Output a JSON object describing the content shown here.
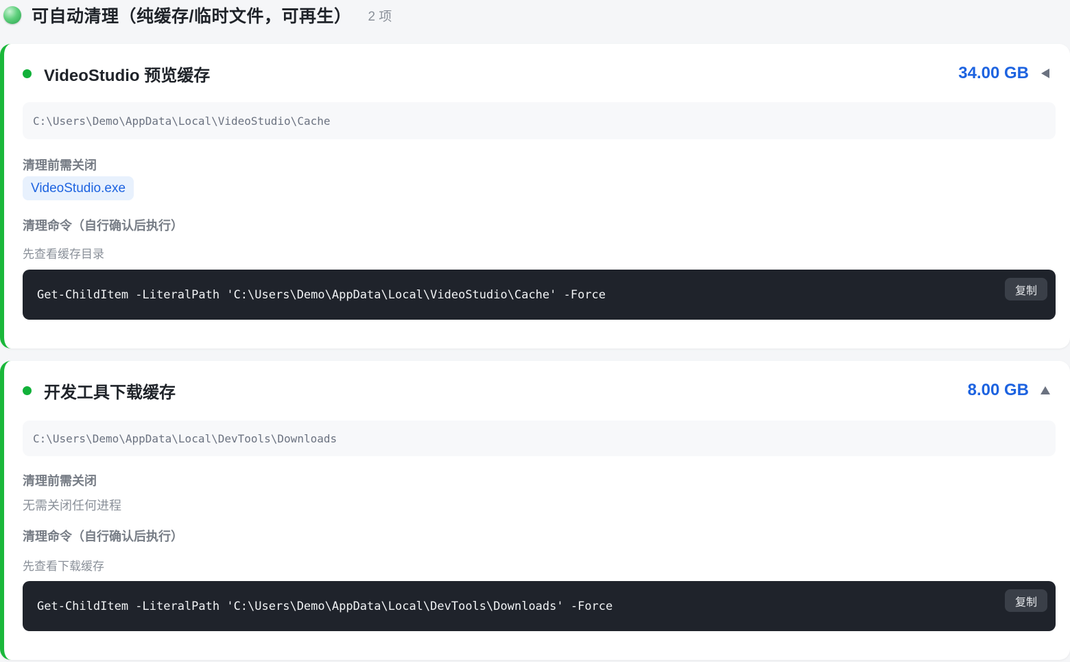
{
  "section": {
    "title": "可自动清理（纯缓存/临时文件，可再生）",
    "count": "2 项"
  },
  "items": [
    {
      "name": "VideoStudio 预览缓存",
      "size": "34.00 GB",
      "expanded": false,
      "path": "C:\\Users\\Demo\\AppData\\Local\\VideoStudio\\Cache",
      "close_label": "清理前需关闭",
      "process": "VideoStudio.exe",
      "command_label": "清理命令（自行确认后执行）",
      "command_hint": "先查看缓存目录",
      "command": "Get-ChildItem -LiteralPath 'C:\\Users\\Demo\\AppData\\Local\\VideoStudio\\Cache' -Force",
      "copy_label": "复制"
    },
    {
      "name": "开发工具下载缓存",
      "size": "8.00 GB",
      "expanded": true,
      "path": "C:\\Users\\Demo\\AppData\\Local\\DevTools\\Downloads",
      "close_label": "清理前需关闭",
      "process_none": "无需关闭任何进程",
      "command_label": "清理命令（自行确认后执行）",
      "command_hint": "先查看下载缓存",
      "command": "Get-ChildItem -LiteralPath 'C:\\Users\\Demo\\AppData\\Local\\DevTools\\Downloads' -Force",
      "copy_label": "复制"
    }
  ],
  "colors": {
    "accent_green": "#1ab83a",
    "size_blue": "#1d63e0",
    "code_bg": "#1f232b"
  }
}
